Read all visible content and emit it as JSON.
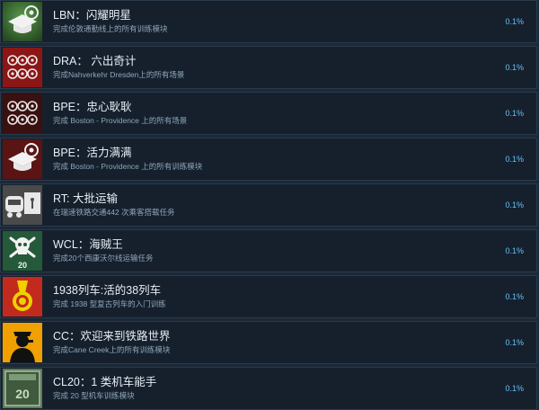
{
  "achievements": [
    {
      "icon": "graduation-cap-target-icon",
      "title": "LBN：闪耀明星",
      "desc": "完成伦敦通勤线上的所有训练模块",
      "pct": "0.1%"
    },
    {
      "icon": "targets-grid-icon",
      "title": "DRA： 六出奇计",
      "desc": "完成Nahverkehr Dresden上的所有场景",
      "pct": "0.1%"
    },
    {
      "icon": "targets-grid-icon",
      "title": "BPE：忠心耿耿",
      "desc": "完成 Boston - Providence 上的所有场景",
      "pct": "0.1%"
    },
    {
      "icon": "graduation-cap-target-icon",
      "title": "BPE：活力满满",
      "desc": "完成 Boston - Providence 上的所有训练模块",
      "pct": "0.1%"
    },
    {
      "icon": "train-delivery-icon",
      "title": "RT: 大批运输",
      "desc": "在瑞速铁路交通442 次乘客搭载任务",
      "pct": "0.1%"
    },
    {
      "icon": "skull-crossbones-icon",
      "title": "WCL：海贼王",
      "desc": "完成20个西康沃尔线运输任务",
      "pct": "0.1%"
    },
    {
      "icon": "medal-icon",
      "title": "1938列车:活的38列车",
      "desc": "完成 1938 型复古列车的入门训练",
      "pct": "0.1%"
    },
    {
      "icon": "conductor-silhouette-icon",
      "title": "CC：欢迎来到铁路世界",
      "desc": "完成Cane Creek上的所有训练模块",
      "pct": "0.1%"
    },
    {
      "icon": "locomotive-plate-icon",
      "title": "CL20：1 类机车能手",
      "desc": "完成 20 型机车训练模块",
      "pct": "0.1%"
    }
  ],
  "icon_texts": {
    "skull_count": "20",
    "plate_number": "20"
  },
  "colors": {
    "background": "#1b2838",
    "row": "#16202d",
    "accent": "#66c0f4"
  }
}
